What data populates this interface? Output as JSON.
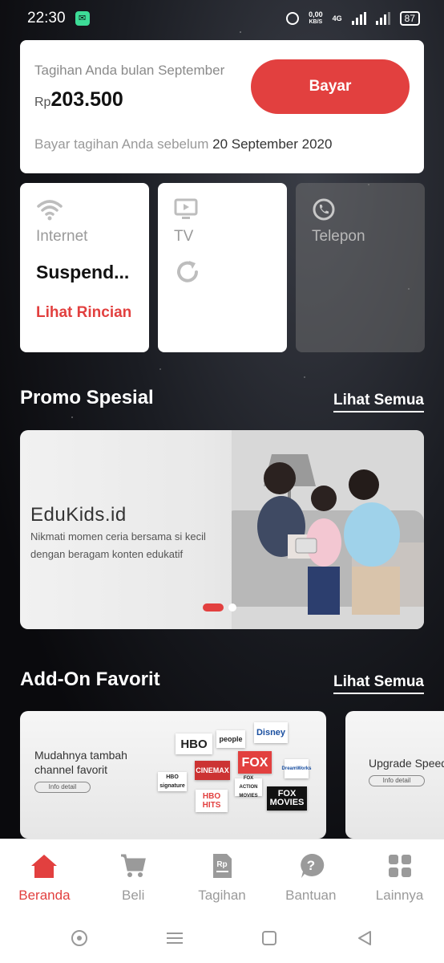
{
  "status_bar": {
    "time": "22:30",
    "net_speed": "0,00",
    "net_unit": "KB/S",
    "network_type": "4G",
    "battery": "87"
  },
  "bill": {
    "title": "Tagihan Anda bulan September",
    "currency": "Rp",
    "amount": "203.500",
    "pay_label": "Bayar",
    "due_prefix": "Bayar tagihan Anda sebelum",
    "due_date": "20 September 2020"
  },
  "services": [
    {
      "label": "Internet",
      "status": "Suspend...",
      "link": "Lihat Rincian",
      "icon": "wifi-icon"
    },
    {
      "label": "TV",
      "icon": "tv-icon"
    },
    {
      "label": "Telepon",
      "icon": "phone-icon"
    }
  ],
  "promo_section": {
    "title": "Promo Spesial",
    "see_all": "Lihat Semua",
    "banner": {
      "title": "EduKids.id",
      "description": "Nikmati momen ceria bersama si kecil dengan beragam konten edukatif"
    }
  },
  "addon_section": {
    "title": "Add-On Favorit",
    "see_all": "Lihat Semua",
    "cards": [
      {
        "text": "Mudahnya tambah channel favorit",
        "button": "Info detail",
        "logos": [
          "HBO",
          "people",
          "Disney",
          "FOX",
          "CINEMAX",
          "HBO signature",
          "HBO HITS",
          "FOX ACTION MOVIES",
          "FOX MOVIES",
          "DreamWorks"
        ]
      },
      {
        "text": "Upgrade Speed",
        "button": "Info detail"
      }
    ]
  },
  "bottom_nav": [
    {
      "label": "Beranda",
      "icon": "home-icon",
      "active": true
    },
    {
      "label": "Beli",
      "icon": "cart-icon"
    },
    {
      "label": "Tagihan",
      "icon": "bill-icon"
    },
    {
      "label": "Bantuan",
      "icon": "help-icon"
    },
    {
      "label": "Lainnya",
      "icon": "grid-icon"
    }
  ],
  "colors": {
    "accent": "#e2403f",
    "inactive": "#9a9a9a"
  }
}
